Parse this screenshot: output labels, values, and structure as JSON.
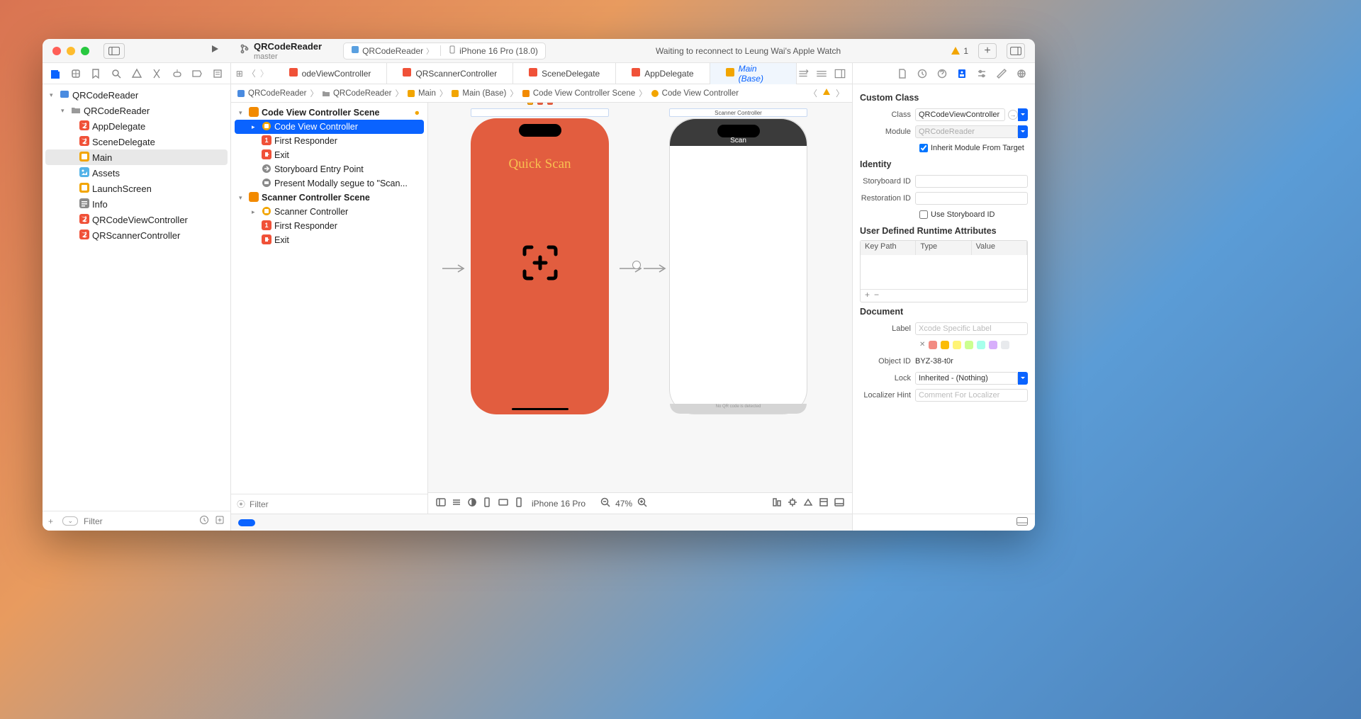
{
  "titlebar": {
    "project": "QRCodeReader",
    "branch": "master",
    "scheme": "QRCodeReader",
    "device": "iPhone 16 Pro (18.0)",
    "status": "Waiting to reconnect to Leung Wai's Apple Watch",
    "warn_count": "1"
  },
  "navigator": {
    "root": "QRCodeReader",
    "folder": "QRCodeReader",
    "items": [
      {
        "name": "AppDelegate",
        "kind": "swift"
      },
      {
        "name": "SceneDelegate",
        "kind": "swift"
      },
      {
        "name": "Main",
        "kind": "storyboard",
        "selected": true
      },
      {
        "name": "Assets",
        "kind": "assets"
      },
      {
        "name": "LaunchScreen",
        "kind": "storyboard"
      },
      {
        "name": "Info",
        "kind": "plist"
      },
      {
        "name": "QRCodeViewController",
        "kind": "swift"
      },
      {
        "name": "QRScannerController",
        "kind": "swift"
      }
    ],
    "filter_placeholder": "Filter"
  },
  "tabs": [
    {
      "label": "odeViewController",
      "kind": "swift"
    },
    {
      "label": "QRScannerController",
      "kind": "swift"
    },
    {
      "label": "SceneDelegate",
      "kind": "swift"
    },
    {
      "label": "AppDelegate",
      "kind": "swift"
    },
    {
      "label": "Main (Base)",
      "kind": "storyboard",
      "active": true
    }
  ],
  "jumpbar": {
    "crumbs": [
      "QRCodeReader",
      "QRCodeReader",
      "Main",
      "Main (Base)",
      "Code View Controller Scene",
      "Code View Controller"
    ]
  },
  "outline": {
    "scenes": [
      {
        "title": "Code View Controller Scene",
        "items": [
          {
            "label": "Code View Controller",
            "kind": "vc",
            "selected": true,
            "expandable": true
          },
          {
            "label": "First Responder",
            "kind": "responder"
          },
          {
            "label": "Exit",
            "kind": "exit"
          },
          {
            "label": "Storyboard Entry Point",
            "kind": "entry"
          },
          {
            "label": "Present Modally segue to \"Scan...",
            "kind": "segue"
          }
        ]
      },
      {
        "title": "Scanner Controller Scene",
        "items": [
          {
            "label": "Scanner Controller",
            "kind": "vc",
            "expandable": true
          },
          {
            "label": "First Responder",
            "kind": "responder"
          },
          {
            "label": "Exit",
            "kind": "exit"
          }
        ]
      }
    ],
    "filter_placeholder": "Filter"
  },
  "canvas": {
    "scene1": {
      "title": "",
      "label": "Quick Scan"
    },
    "scene2": {
      "title": "Scanner Controller",
      "nav": "Scan",
      "bottom": "No QR code is detected"
    },
    "device": "iPhone 16 Pro",
    "zoom": "47%"
  },
  "inspector": {
    "sections": {
      "custom_class": {
        "header": "Custom Class",
        "class": "QRCodeViewController",
        "module": "QRCodeReader",
        "inherit": "Inherit Module From Target"
      },
      "identity": {
        "header": "Identity",
        "storyboard_id": "",
        "restoration_id": "",
        "use_sb": "Use Storyboard ID"
      },
      "runtime_attrs": {
        "header": "User Defined Runtime Attributes",
        "cols": [
          "Key Path",
          "Type",
          "Value"
        ]
      },
      "document": {
        "header": "Document",
        "label_ph": "Xcode Specific Label",
        "object_id": "BYZ-38-t0r",
        "lock": "Inherited - (Nothing)",
        "localizer_ph": "Comment For Localizer",
        "label_label": "Label",
        "object_id_label": "Object ID",
        "lock_label": "Lock",
        "localizer_label": "Localizer Hint"
      }
    },
    "labels": {
      "class": "Class",
      "module": "Module",
      "storyboard_id": "Storyboard ID",
      "restoration_id": "Restoration ID"
    }
  }
}
